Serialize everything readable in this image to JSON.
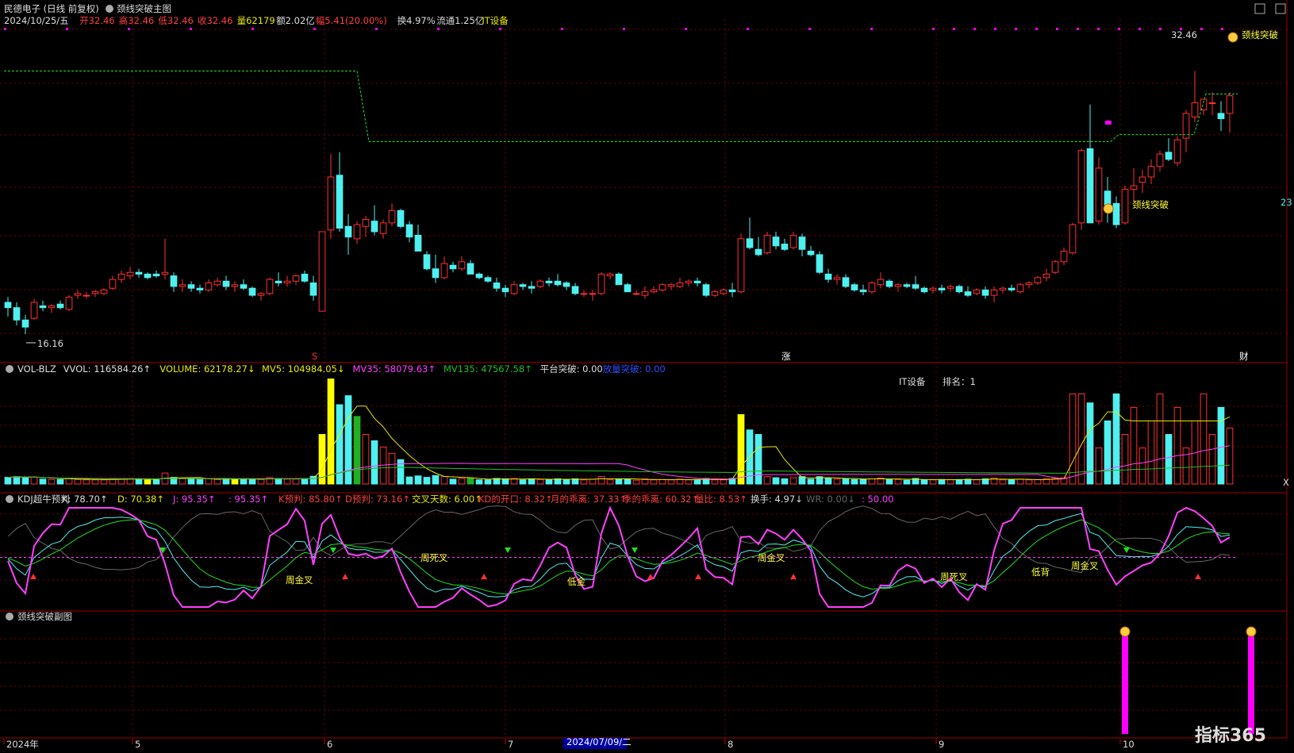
{
  "header": {
    "title_stock": "民德电子 (日线 前复权)",
    "title_indicator": "颈线突破主图",
    "quote": [
      {
        "text": "2024/10/25/五",
        "color": "#dddddd"
      },
      {
        "text": "开32.46",
        "color": "#ff4040"
      },
      {
        "text": "高32.46",
        "color": "#ff4040"
      },
      {
        "text": "低32.46",
        "color": "#ff4040"
      },
      {
        "text": "收32.46",
        "color": "#ff4040"
      },
      {
        "text": "量62179",
        "color": "#e8e800"
      },
      {
        "text": "额2.02亿",
        "color": "#dddddd"
      },
      {
        "text": "幅5.41(20.00%)",
        "color": "#ff4040"
      },
      {
        "text": "换4.97%",
        "color": "#dddddd"
      },
      {
        "text": "流通1.25亿",
        "color": "#dddddd"
      },
      {
        "text": "IT设备",
        "color": "#e8e800"
      }
    ]
  },
  "main_panel": {
    "high_label": "32.46",
    "low_label": "16.16",
    "signal_label": "颈线突破",
    "top_right_tag": "颈线突破",
    "edge_label": "23",
    "bottom_markers": [
      {
        "text": "S",
        "color": "#ff3030"
      },
      {
        "text": "涨",
        "color": "#ffffff"
      },
      {
        "text": "财",
        "color": "#ffffff"
      }
    ]
  },
  "vol_panel": {
    "legend": [
      {
        "text": "VOL-BLZ",
        "color": "#dddddd"
      },
      {
        "text": "VVOL: 116584.26↑",
        "color": "#dddddd"
      },
      {
        "text": "VOLUME: 62178.27↓",
        "color": "#e8e800"
      },
      {
        "text": "MV5: 104984.05↓",
        "color": "#e8e800"
      },
      {
        "text": "MV35: 58079.63↑",
        "color": "#ff40ff"
      },
      {
        "text": "MV135: 47567.58↑",
        "color": "#20c020"
      },
      {
        "text": "平台突破: 0.00",
        "color": "#dddddd"
      },
      {
        "text": "放量突破: 0.00",
        "color": "#3050ff"
      }
    ],
    "sector": "IT设备",
    "rank": "排名：1",
    "edge_x": "X"
  },
  "kdj_panel": {
    "legend": [
      {
        "text": "KDJ超牛预判",
        "color": "#dddddd"
      },
      {
        "text": "K: 78.70↑",
        "color": "#dddddd"
      },
      {
        "text": "D: 70.38↑",
        "color": "#e8e800"
      },
      {
        "text": "J: 95.35↑",
        "color": "#ff40ff"
      },
      {
        "text": ": 95.35↑",
        "color": "#ff40ff"
      },
      {
        "text": "K预判: 85.80↑",
        "color": "#ff4040"
      },
      {
        "text": "D预判: 73.16↑",
        "color": "#ff4040"
      },
      {
        "text": "交叉天数: 6.00↑",
        "color": "#e8e800"
      },
      {
        "text": "KD的开口: 8.32↑",
        "color": "#ff4040"
      },
      {
        "text": "月的乖离: 37.33↑",
        "color": "#ff4040"
      },
      {
        "text": "季的乖离: 60.32↑",
        "color": "#ff4040"
      },
      {
        "text": "量比: 8.53↑",
        "color": "#ff4040"
      },
      {
        "text": "换手: 4.97↓",
        "color": "#dddddd"
      },
      {
        "text": "WR: 0.00↓",
        "color": "#666666"
      },
      {
        "text": ": 50.00",
        "color": "#ff40ff"
      }
    ],
    "labels": [
      "周金叉",
      "周死叉",
      "低金",
      "周金叉",
      "周死叉",
      "低背",
      "周金叉"
    ]
  },
  "sub_panel": {
    "title": "颈线突破副图"
  },
  "xaxis": {
    "labels": [
      "2024年",
      "5",
      "6",
      "7",
      "8",
      "9",
      "10"
    ],
    "highlight": "2024/07/09/二"
  },
  "watermark": "指标365",
  "colors": {
    "up": "#ff3030",
    "down": "#4ef0f0",
    "vol_up": "#ff3030",
    "vol_down": "#4ef0f0",
    "vol_yellow": "#ffff00",
    "grid": "#7a0000",
    "pink": "#ff00ff",
    "green_line": "#20e020"
  },
  "chart_data": {
    "type": "candlestick",
    "x_range": [
      "2024-01",
      "2024-10-25"
    ],
    "price_low_marked": 16.16,
    "price_high_marked": 32.46,
    "candles": [
      [
        17.9,
        18.2,
        17.1,
        17.6
      ],
      [
        17.6,
        17.9,
        16.6,
        16.9
      ],
      [
        16.9,
        17.2,
        16.1,
        16.5
      ],
      [
        17.0,
        18.1,
        16.9,
        17.9
      ],
      [
        17.7,
        18.0,
        17.4,
        17.6
      ],
      [
        17.6,
        17.8,
        17.3,
        17.7
      ],
      [
        17.8,
        18.0,
        17.5,
        17.6
      ],
      [
        17.5,
        18.3,
        17.4,
        18.2
      ],
      [
        18.3,
        18.6,
        18.1,
        18.4
      ],
      [
        18.3,
        18.5,
        18.1,
        18.3
      ],
      [
        18.4,
        18.6,
        18.2,
        18.5
      ],
      [
        18.4,
        18.7,
        18.3,
        18.6
      ],
      [
        18.7,
        19.4,
        18.6,
        19.2
      ],
      [
        19.2,
        19.7,
        19.0,
        19.5
      ],
      [
        19.4,
        19.9,
        19.2,
        19.6
      ],
      [
        19.6,
        19.8,
        19.3,
        19.5
      ],
      [
        19.5,
        19.6,
        19.2,
        19.3
      ],
      [
        19.5,
        19.7,
        19.3,
        19.4
      ],
      [
        19.5,
        21.5,
        19.2,
        19.6
      ],
      [
        19.4,
        19.6,
        18.5,
        18.8
      ],
      [
        18.8,
        19.2,
        18.5,
        18.9
      ],
      [
        18.9,
        19.1,
        18.5,
        18.7
      ],
      [
        18.7,
        18.9,
        18.4,
        18.6
      ],
      [
        18.6,
        19.2,
        18.5,
        19.0
      ],
      [
        18.9,
        19.3,
        18.8,
        19.1
      ],
      [
        19.1,
        19.4,
        18.6,
        18.8
      ],
      [
        18.8,
        19.1,
        18.5,
        18.9
      ],
      [
        18.9,
        19.2,
        18.6,
        18.7
      ],
      [
        18.7,
        18.8,
        18.2,
        18.3
      ],
      [
        18.3,
        18.5,
        18.0,
        18.4
      ],
      [
        18.4,
        19.3,
        18.3,
        19.2
      ],
      [
        19.1,
        19.6,
        18.8,
        19.0
      ],
      [
        19.0,
        19.4,
        18.8,
        19.1
      ],
      [
        19.1,
        19.5,
        18.9,
        19.4
      ],
      [
        19.5,
        19.7,
        19.0,
        19.1
      ],
      [
        19.0,
        19.4,
        18.0,
        18.3
      ],
      [
        17.4,
        21.9,
        17.4,
        21.9
      ],
      [
        22.0,
        26.3,
        21.5,
        25.0
      ],
      [
        25.1,
        26.4,
        21.9,
        22.1
      ],
      [
        22.2,
        22.9,
        20.6,
        21.6
      ],
      [
        21.5,
        22.5,
        21.2,
        22.3
      ],
      [
        22.2,
        22.8,
        21.6,
        22.6
      ],
      [
        22.5,
        23.4,
        21.7,
        21.9
      ],
      [
        21.8,
        22.6,
        21.5,
        22.4
      ],
      [
        22.4,
        23.5,
        22.2,
        23.1
      ],
      [
        23.1,
        23.2,
        22.1,
        22.2
      ],
      [
        22.3,
        22.5,
        21.3,
        21.6
      ],
      [
        21.7,
        22.3,
        20.8,
        20.8
      ],
      [
        20.6,
        20.8,
        19.7,
        19.8
      ],
      [
        19.8,
        20.6,
        19.0,
        19.3
      ],
      [
        19.3,
        20.5,
        19.2,
        20.1
      ],
      [
        20.0,
        20.2,
        19.6,
        19.8
      ],
      [
        19.8,
        20.5,
        19.7,
        20.2
      ],
      [
        20.1,
        20.3,
        19.5,
        19.5
      ],
      [
        19.5,
        19.6,
        19.2,
        19.3
      ],
      [
        19.3,
        19.4,
        19.0,
        19.1
      ],
      [
        19.0,
        19.3,
        18.5,
        18.7
      ],
      [
        18.7,
        18.9,
        18.2,
        18.5
      ],
      [
        18.4,
        19.1,
        18.3,
        18.9
      ],
      [
        18.9,
        19.0,
        18.6,
        18.8
      ],
      [
        18.8,
        19.1,
        18.4,
        18.7
      ],
      [
        18.8,
        19.2,
        18.7,
        19.1
      ],
      [
        19.1,
        19.3,
        18.8,
        19.0
      ],
      [
        19.1,
        19.5,
        18.8,
        18.9
      ],
      [
        19.0,
        19.1,
        18.6,
        18.8
      ],
      [
        18.8,
        19.0,
        18.3,
        18.4
      ],
      [
        18.4,
        18.6,
        18.2,
        18.4
      ],
      [
        18.4,
        18.6,
        18.0,
        18.4
      ],
      [
        18.4,
        19.6,
        18.3,
        19.5
      ],
      [
        19.4,
        19.6,
        19.2,
        19.5
      ],
      [
        19.5,
        19.6,
        18.9,
        18.9
      ],
      [
        18.9,
        19.0,
        18.5,
        18.5
      ],
      [
        18.4,
        18.6,
        18.3,
        18.4
      ],
      [
        18.3,
        18.8,
        18.1,
        18.5
      ],
      [
        18.5,
        18.8,
        18.4,
        18.6
      ],
      [
        18.6,
        19.0,
        18.5,
        18.9
      ],
      [
        18.8,
        19.0,
        18.6,
        18.9
      ],
      [
        18.8,
        19.3,
        18.7,
        19.0
      ],
      [
        19.0,
        19.2,
        18.8,
        19.1
      ],
      [
        19.1,
        19.3,
        18.8,
        19.0
      ],
      [
        18.9,
        19.0,
        18.2,
        18.3
      ],
      [
        18.3,
        18.6,
        18.2,
        18.5
      ],
      [
        18.4,
        18.7,
        18.3,
        18.6
      ],
      [
        18.6,
        19.0,
        18.2,
        18.5
      ],
      [
        18.5,
        21.8,
        18.4,
        21.5
      ],
      [
        21.5,
        22.7,
        20.9,
        21.0
      ],
      [
        20.9,
        21.6,
        20.5,
        20.6
      ],
      [
        20.7,
        21.9,
        20.6,
        21.7
      ],
      [
        21.6,
        21.9,
        20.9,
        21.1
      ],
      [
        21.2,
        21.5,
        20.8,
        20.9
      ],
      [
        21.0,
        21.9,
        20.9,
        21.7
      ],
      [
        21.6,
        21.8,
        20.5,
        20.9
      ],
      [
        20.8,
        21.1,
        20.5,
        20.6
      ],
      [
        20.6,
        20.8,
        19.5,
        19.6
      ],
      [
        19.5,
        19.8,
        19.0,
        19.2
      ],
      [
        19.2,
        19.5,
        18.9,
        19.3
      ],
      [
        19.3,
        19.5,
        18.7,
        18.8
      ],
      [
        18.9,
        19.0,
        18.5,
        18.6
      ],
      [
        18.6,
        18.9,
        18.3,
        18.5
      ],
      [
        18.5,
        19.1,
        18.4,
        19.0
      ],
      [
        18.9,
        19.6,
        18.7,
        19.2
      ],
      [
        19.1,
        19.2,
        18.7,
        18.8
      ],
      [
        18.8,
        19.0,
        18.5,
        18.9
      ],
      [
        18.9,
        19.0,
        18.7,
        18.8
      ],
      [
        18.9,
        19.4,
        18.6,
        18.7
      ],
      [
        18.7,
        18.8,
        18.4,
        18.5
      ],
      [
        18.6,
        18.8,
        18.4,
        18.7
      ],
      [
        18.7,
        18.9,
        18.4,
        18.6
      ],
      [
        18.7,
        18.9,
        18.5,
        18.8
      ],
      [
        18.8,
        18.9,
        18.4,
        18.5
      ],
      [
        18.5,
        18.8,
        18.2,
        18.3
      ],
      [
        18.4,
        18.7,
        18.3,
        18.6
      ],
      [
        18.6,
        18.8,
        18.1,
        18.3
      ],
      [
        18.3,
        18.8,
        17.9,
        18.6
      ],
      [
        18.6,
        18.8,
        18.4,
        18.7
      ],
      [
        18.7,
        18.9,
        18.5,
        18.6
      ],
      [
        18.5,
        19.0,
        18.4,
        18.9
      ],
      [
        18.9,
        19.1,
        18.7,
        19.0
      ],
      [
        19.0,
        19.4,
        18.9,
        19.3
      ],
      [
        19.3,
        19.8,
        19.1,
        19.5
      ],
      [
        19.6,
        20.3,
        19.5,
        20.2
      ],
      [
        20.2,
        21.0,
        20.0,
        20.8
      ],
      [
        20.7,
        22.4,
        20.6,
        22.3
      ],
      [
        22.4,
        26.6,
        22.0,
        26.5
      ],
      [
        26.6,
        29.1,
        22.4,
        22.4
      ],
      [
        22.5,
        26.1,
        22.3,
        25.5
      ],
      [
        24.2,
        25.0,
        22.4,
        23.1
      ],
      [
        23.5,
        23.9,
        22.1,
        22.3
      ],
      [
        22.4,
        24.5,
        22.3,
        24.3
      ],
      [
        24.3,
        25.5,
        23.6,
        24.5
      ],
      [
        24.7,
        25.4,
        24.1,
        25.0
      ],
      [
        25.0,
        26.0,
        24.6,
        25.6
      ],
      [
        25.6,
        26.5,
        25.3,
        26.3
      ],
      [
        26.4,
        27.2,
        25.9,
        26.0
      ],
      [
        25.8,
        27.3,
        25.6,
        27.1
      ],
      [
        27.2,
        28.8,
        26.4,
        28.6
      ],
      [
        28.4,
        31.0,
        28.1,
        29.2
      ],
      [
        28.8,
        29.4,
        28.5,
        29.4
      ],
      [
        29.2,
        29.8,
        28.5,
        29.2
      ],
      [
        28.6,
        29.3,
        27.6,
        28.3
      ],
      [
        28.6,
        29.8,
        27.5,
        29.6
      ]
    ],
    "volume_peak": 116584.26,
    "volume_last": 62178.27,
    "kdj_last": {
      "K": 78.7,
      "D": 70.38,
      "J": 95.35
    }
  }
}
